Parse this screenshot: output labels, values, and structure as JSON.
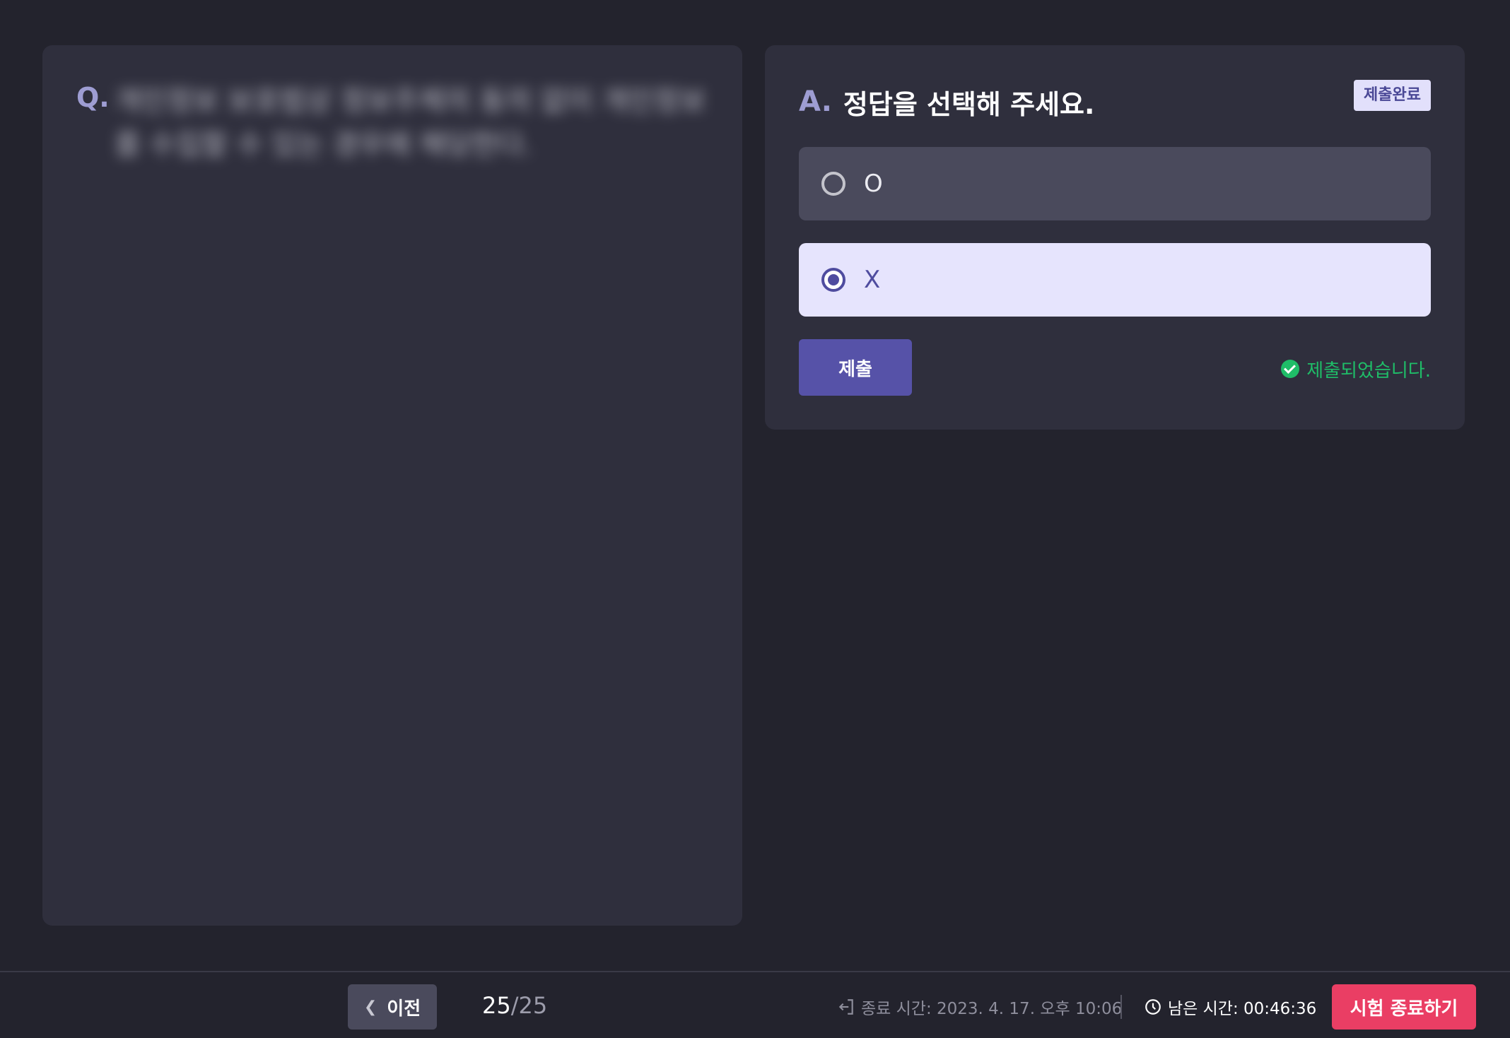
{
  "question": {
    "prefix": "Q.",
    "text": "개인정보 보호법상 정보주체의 동의 없이 개인정보를 수집할 수 있는 경우에 해당한다."
  },
  "answer": {
    "prefix": "A.",
    "title": "정답을 선택해 주세요.",
    "status_chip": "제출완료",
    "options": [
      {
        "label": "O",
        "selected": false
      },
      {
        "label": "X",
        "selected": true
      }
    ],
    "submit_label": "제출",
    "submitted_message": "제출되었습니다."
  },
  "footer": {
    "prev_label": "이전",
    "page_current": "25",
    "page_total": "/25",
    "end_time": "종료 시간: 2023. 4. 17. 오후 10:06",
    "remaining_time": "남은 시간: 00:46:36",
    "end_exam_label": "시험 종료하기"
  },
  "colors": {
    "background": "#23232d",
    "panel": "#2f2f3d",
    "accent": "#5652a8",
    "success": "#1fbd68",
    "danger": "#ea3e64"
  },
  "icons": [
    "chevron-left-icon",
    "exit-icon",
    "clock-icon",
    "check-circle-icon",
    "radio-icon"
  ]
}
